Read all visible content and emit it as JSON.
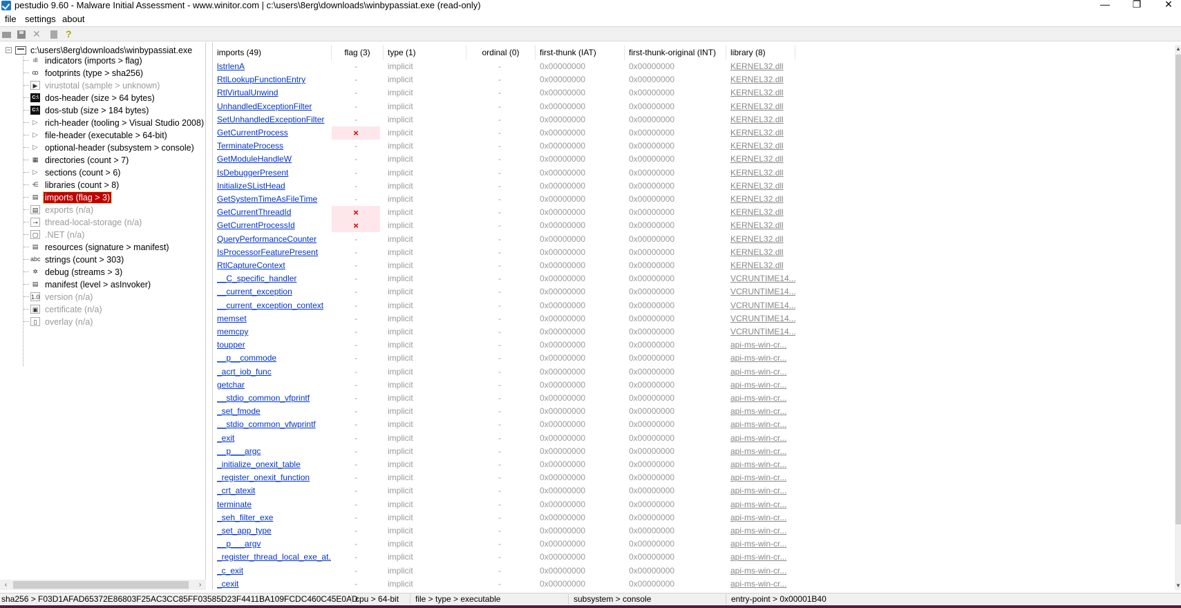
{
  "window": {
    "title": "pestudio 9.60 - Malware Initial Assessment - www.winitor.com | c:\\users\\8erg\\downloads\\winbypassiat.exe (read-only)",
    "minimize_glyph": "—",
    "maximize_glyph": "❐",
    "close_glyph": "✕"
  },
  "menu": {
    "file": "file",
    "settings": "settings",
    "about": "about"
  },
  "toolbar": {
    "cut_glyph": "✕",
    "help_glyph": "?"
  },
  "tree": {
    "root": "c:\\users\\8erg\\downloads\\winbypassiat.exe",
    "root_expander": "−",
    "items": [
      {
        "label": "indicators (imports > flag)",
        "icon": "bar-chart-icon",
        "glyph": "ıll",
        "disabled": false
      },
      {
        "label": "footprints (type > sha256)",
        "icon": "footprints-icon",
        "glyph": "ꝏ",
        "disabled": false
      },
      {
        "label": "virustotal (sample > unknown)",
        "icon": "virustotal-icon",
        "glyph": "▶",
        "disabled": true
      },
      {
        "label": "dos-header (size > 64 bytes)",
        "icon": "dos-header-icon",
        "glyph": "C:\\",
        "disabled": false
      },
      {
        "label": "dos-stub (size > 184 bytes)",
        "icon": "dos-stub-icon",
        "glyph": "C:\\",
        "disabled": false
      },
      {
        "label": "rich-header (tooling > Visual Studio 2008)",
        "icon": "expand-arrow-icon",
        "glyph": "▷",
        "disabled": false
      },
      {
        "label": "file-header (executable > 64-bit)",
        "icon": "expand-arrow-icon",
        "glyph": "▷",
        "disabled": false
      },
      {
        "label": "optional-header (subsystem > console)",
        "icon": "expand-arrow-icon",
        "glyph": "▷",
        "disabled": false
      },
      {
        "label": "directories (count > 7)",
        "icon": "directories-icon",
        "glyph": "▦",
        "disabled": false
      },
      {
        "label": "sections (count > 6)",
        "icon": "expand-arrow-icon",
        "glyph": "▷",
        "disabled": false
      },
      {
        "label": "libraries (count > 8)",
        "icon": "libraries-icon",
        "glyph": "⋲",
        "disabled": false
      },
      {
        "label": "imports (flag > 3)",
        "icon": "imports-icon",
        "glyph": "▤",
        "disabled": false,
        "selected": true
      },
      {
        "label": "exports (n/a)",
        "icon": "exports-icon",
        "glyph": "▤",
        "disabled": true
      },
      {
        "label": "thread-local-storage (n/a)",
        "icon": "tls-icon",
        "glyph": "⊸",
        "disabled": true
      },
      {
        "label": ".NET (n/a)",
        "icon": "dotnet-icon",
        "glyph": "▢",
        "disabled": true
      },
      {
        "label": "resources (signature > manifest)",
        "icon": "resources-icon",
        "glyph": "▤",
        "disabled": false
      },
      {
        "label": "strings (count > 303)",
        "icon": "strings-icon",
        "glyph": "abc",
        "disabled": false
      },
      {
        "label": "debug (streams > 3)",
        "icon": "debug-icon",
        "glyph": "✲",
        "disabled": false
      },
      {
        "label": "manifest (level > asInvoker)",
        "icon": "manifest-icon",
        "glyph": "▤",
        "disabled": false
      },
      {
        "label": "version (n/a)",
        "icon": "version-icon",
        "glyph": "1.0",
        "disabled": true
      },
      {
        "label": "certificate (n/a)",
        "icon": "certificate-icon",
        "glyph": "▣",
        "disabled": true
      },
      {
        "label": "overlay (n/a)",
        "icon": "overlay-icon",
        "glyph": "▯",
        "disabled": true
      }
    ],
    "scroll_left": "‹",
    "scroll_right": "›"
  },
  "table": {
    "headers": {
      "imports": "imports (49)",
      "flag": "flag (3)",
      "type": "type (1)",
      "ordinal": "ordinal (0)",
      "iat": "first-thunk (IAT)",
      "int": "first-thunk-original (INT)",
      "library": "library (8)"
    },
    "default_type": "implicit",
    "default_ordinal": "-",
    "default_thunk": "0x00000000",
    "flag_mark": "×",
    "flag_none": "-",
    "rows": [
      {
        "name": "lstrlenA",
        "flag": false,
        "library": "KERNEL32.dll"
      },
      {
        "name": "RtlLookupFunctionEntry",
        "flag": false,
        "library": "KERNEL32.dll"
      },
      {
        "name": "RtlVirtualUnwind",
        "flag": false,
        "library": "KERNEL32.dll"
      },
      {
        "name": "UnhandledExceptionFilter",
        "flag": false,
        "library": "KERNEL32.dll"
      },
      {
        "name": "SetUnhandledExceptionFilter",
        "flag": false,
        "library": "KERNEL32.dll"
      },
      {
        "name": "GetCurrentProcess",
        "flag": true,
        "library": "KERNEL32.dll"
      },
      {
        "name": "TerminateProcess",
        "flag": false,
        "library": "KERNEL32.dll"
      },
      {
        "name": "GetModuleHandleW",
        "flag": false,
        "library": "KERNEL32.dll"
      },
      {
        "name": "IsDebuggerPresent",
        "flag": false,
        "library": "KERNEL32.dll"
      },
      {
        "name": "InitializeSListHead",
        "flag": false,
        "library": "KERNEL32.dll"
      },
      {
        "name": "GetSystemTimeAsFileTime",
        "flag": false,
        "library": "KERNEL32.dll"
      },
      {
        "name": "GetCurrentThreadId",
        "flag": true,
        "library": "KERNEL32.dll"
      },
      {
        "name": "GetCurrentProcessId",
        "flag": true,
        "library": "KERNEL32.dll"
      },
      {
        "name": "QueryPerformanceCounter",
        "flag": false,
        "library": "KERNEL32.dll"
      },
      {
        "name": "IsProcessorFeaturePresent",
        "flag": false,
        "library": "KERNEL32.dll"
      },
      {
        "name": "RtlCaptureContext",
        "flag": false,
        "library": "KERNEL32.dll"
      },
      {
        "name": "__C_specific_handler",
        "flag": false,
        "library": "VCRUNTIME14..."
      },
      {
        "name": "__current_exception",
        "flag": false,
        "library": "VCRUNTIME14..."
      },
      {
        "name": "__current_exception_context",
        "flag": false,
        "library": "VCRUNTIME14..."
      },
      {
        "name": "memset",
        "flag": false,
        "library": "VCRUNTIME14..."
      },
      {
        "name": "memcpy",
        "flag": false,
        "library": "VCRUNTIME14..."
      },
      {
        "name": "toupper",
        "flag": false,
        "library": "api-ms-win-cr..."
      },
      {
        "name": "__p__commode",
        "flag": false,
        "library": "api-ms-win-cr..."
      },
      {
        "name": "_acrt_iob_func",
        "flag": false,
        "library": "api-ms-win-cr..."
      },
      {
        "name": "getchar",
        "flag": false,
        "library": "api-ms-win-cr..."
      },
      {
        "name": "__stdio_common_vfprintf",
        "flag": false,
        "library": "api-ms-win-cr..."
      },
      {
        "name": "_set_fmode",
        "flag": false,
        "library": "api-ms-win-cr..."
      },
      {
        "name": "__stdio_common_vfwprintf",
        "flag": false,
        "library": "api-ms-win-cr..."
      },
      {
        "name": "_exit",
        "flag": false,
        "library": "api-ms-win-cr..."
      },
      {
        "name": "__p___argc",
        "flag": false,
        "library": "api-ms-win-cr..."
      },
      {
        "name": "_initialize_onexit_table",
        "flag": false,
        "library": "api-ms-win-cr..."
      },
      {
        "name": "_register_onexit_function",
        "flag": false,
        "library": "api-ms-win-cr..."
      },
      {
        "name": "_crt_atexit",
        "flag": false,
        "library": "api-ms-win-cr..."
      },
      {
        "name": "terminate",
        "flag": false,
        "library": "api-ms-win-cr..."
      },
      {
        "name": "_seh_filter_exe",
        "flag": false,
        "library": "api-ms-win-cr..."
      },
      {
        "name": "_set_app_type",
        "flag": false,
        "library": "api-ms-win-cr..."
      },
      {
        "name": "__p___argv",
        "flag": false,
        "library": "api-ms-win-cr..."
      },
      {
        "name": "_register_thread_local_exe_at...",
        "flag": false,
        "library": "api-ms-win-cr..."
      },
      {
        "name": "_c_exit",
        "flag": false,
        "library": "api-ms-win-cr..."
      },
      {
        "name": "_cexit",
        "flag": false,
        "library": "api-ms-win-cr..."
      }
    ],
    "scroll_up": "▲",
    "scroll_down": "▼"
  },
  "status": {
    "sha256": "sha256 > F03D1AFAD65372E86803F25AC3CC85FF03585D23F4411BA109FCDC460C45E0AD",
    "cpu": "cpu > 64-bit",
    "file_type": "file > type > executable",
    "subsystem": "subsystem > console",
    "entry_point": "entry-point > 0x00001B40"
  }
}
